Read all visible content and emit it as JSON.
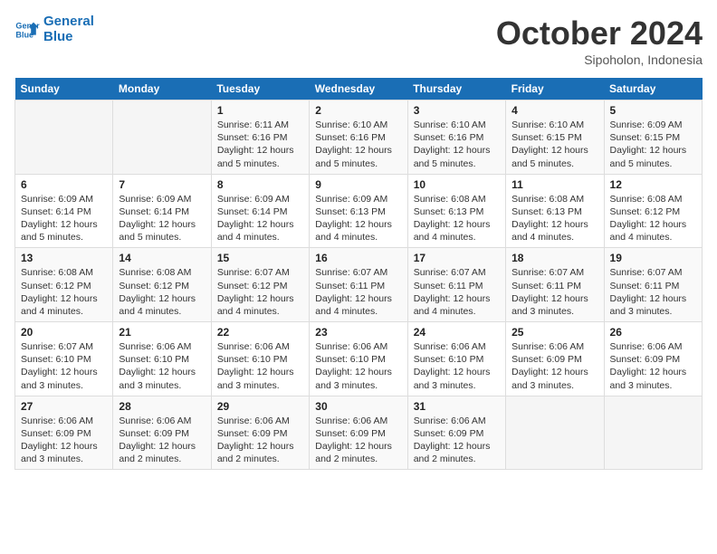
{
  "header": {
    "logo": {
      "line1": "General",
      "line2": "Blue"
    },
    "title": "October 2024",
    "subtitle": "Sipoholon, Indonesia"
  },
  "weekdays": [
    "Sunday",
    "Monday",
    "Tuesday",
    "Wednesday",
    "Thursday",
    "Friday",
    "Saturday"
  ],
  "weeks": [
    [
      {
        "day": "",
        "info": ""
      },
      {
        "day": "",
        "info": ""
      },
      {
        "day": "1",
        "info": "Sunrise: 6:11 AM\nSunset: 6:16 PM\nDaylight: 12 hours\nand 5 minutes."
      },
      {
        "day": "2",
        "info": "Sunrise: 6:10 AM\nSunset: 6:16 PM\nDaylight: 12 hours\nand 5 minutes."
      },
      {
        "day": "3",
        "info": "Sunrise: 6:10 AM\nSunset: 6:16 PM\nDaylight: 12 hours\nand 5 minutes."
      },
      {
        "day": "4",
        "info": "Sunrise: 6:10 AM\nSunset: 6:15 PM\nDaylight: 12 hours\nand 5 minutes."
      },
      {
        "day": "5",
        "info": "Sunrise: 6:09 AM\nSunset: 6:15 PM\nDaylight: 12 hours\nand 5 minutes."
      }
    ],
    [
      {
        "day": "6",
        "info": "Sunrise: 6:09 AM\nSunset: 6:14 PM\nDaylight: 12 hours\nand 5 minutes."
      },
      {
        "day": "7",
        "info": "Sunrise: 6:09 AM\nSunset: 6:14 PM\nDaylight: 12 hours\nand 5 minutes."
      },
      {
        "day": "8",
        "info": "Sunrise: 6:09 AM\nSunset: 6:14 PM\nDaylight: 12 hours\nand 4 minutes."
      },
      {
        "day": "9",
        "info": "Sunrise: 6:09 AM\nSunset: 6:13 PM\nDaylight: 12 hours\nand 4 minutes."
      },
      {
        "day": "10",
        "info": "Sunrise: 6:08 AM\nSunset: 6:13 PM\nDaylight: 12 hours\nand 4 minutes."
      },
      {
        "day": "11",
        "info": "Sunrise: 6:08 AM\nSunset: 6:13 PM\nDaylight: 12 hours\nand 4 minutes."
      },
      {
        "day": "12",
        "info": "Sunrise: 6:08 AM\nSunset: 6:12 PM\nDaylight: 12 hours\nand 4 minutes."
      }
    ],
    [
      {
        "day": "13",
        "info": "Sunrise: 6:08 AM\nSunset: 6:12 PM\nDaylight: 12 hours\nand 4 minutes."
      },
      {
        "day": "14",
        "info": "Sunrise: 6:08 AM\nSunset: 6:12 PM\nDaylight: 12 hours\nand 4 minutes."
      },
      {
        "day": "15",
        "info": "Sunrise: 6:07 AM\nSunset: 6:12 PM\nDaylight: 12 hours\nand 4 minutes."
      },
      {
        "day": "16",
        "info": "Sunrise: 6:07 AM\nSunset: 6:11 PM\nDaylight: 12 hours\nand 4 minutes."
      },
      {
        "day": "17",
        "info": "Sunrise: 6:07 AM\nSunset: 6:11 PM\nDaylight: 12 hours\nand 4 minutes."
      },
      {
        "day": "18",
        "info": "Sunrise: 6:07 AM\nSunset: 6:11 PM\nDaylight: 12 hours\nand 3 minutes."
      },
      {
        "day": "19",
        "info": "Sunrise: 6:07 AM\nSunset: 6:11 PM\nDaylight: 12 hours\nand 3 minutes."
      }
    ],
    [
      {
        "day": "20",
        "info": "Sunrise: 6:07 AM\nSunset: 6:10 PM\nDaylight: 12 hours\nand 3 minutes."
      },
      {
        "day": "21",
        "info": "Sunrise: 6:06 AM\nSunset: 6:10 PM\nDaylight: 12 hours\nand 3 minutes."
      },
      {
        "day": "22",
        "info": "Sunrise: 6:06 AM\nSunset: 6:10 PM\nDaylight: 12 hours\nand 3 minutes."
      },
      {
        "day": "23",
        "info": "Sunrise: 6:06 AM\nSunset: 6:10 PM\nDaylight: 12 hours\nand 3 minutes."
      },
      {
        "day": "24",
        "info": "Sunrise: 6:06 AM\nSunset: 6:10 PM\nDaylight: 12 hours\nand 3 minutes."
      },
      {
        "day": "25",
        "info": "Sunrise: 6:06 AM\nSunset: 6:09 PM\nDaylight: 12 hours\nand 3 minutes."
      },
      {
        "day": "26",
        "info": "Sunrise: 6:06 AM\nSunset: 6:09 PM\nDaylight: 12 hours\nand 3 minutes."
      }
    ],
    [
      {
        "day": "27",
        "info": "Sunrise: 6:06 AM\nSunset: 6:09 PM\nDaylight: 12 hours\nand 3 minutes."
      },
      {
        "day": "28",
        "info": "Sunrise: 6:06 AM\nSunset: 6:09 PM\nDaylight: 12 hours\nand 2 minutes."
      },
      {
        "day": "29",
        "info": "Sunrise: 6:06 AM\nSunset: 6:09 PM\nDaylight: 12 hours\nand 2 minutes."
      },
      {
        "day": "30",
        "info": "Sunrise: 6:06 AM\nSunset: 6:09 PM\nDaylight: 12 hours\nand 2 minutes."
      },
      {
        "day": "31",
        "info": "Sunrise: 6:06 AM\nSunset: 6:09 PM\nDaylight: 12 hours\nand 2 minutes."
      },
      {
        "day": "",
        "info": ""
      },
      {
        "day": "",
        "info": ""
      }
    ]
  ]
}
